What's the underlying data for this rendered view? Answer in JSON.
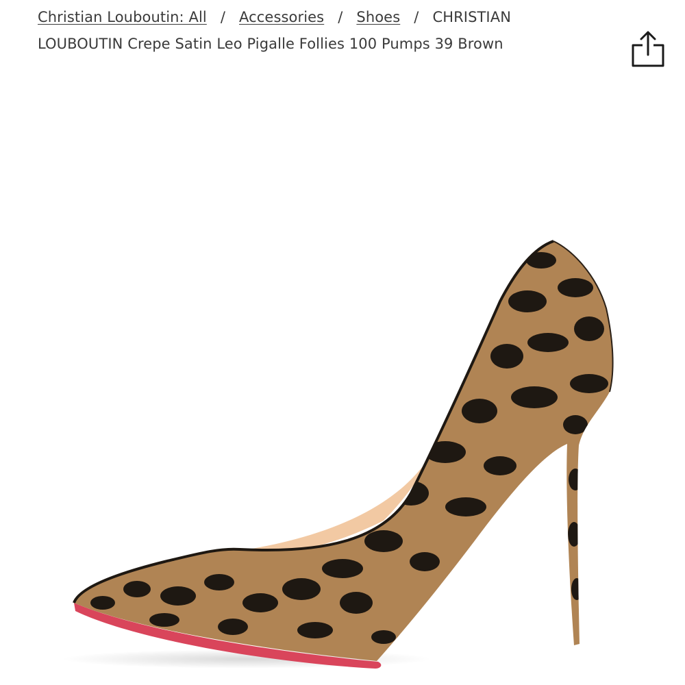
{
  "breadcrumb": {
    "items": [
      {
        "label": "Christian Louboutin: All"
      },
      {
        "label": "Accessories"
      },
      {
        "label": "Shoes"
      }
    ],
    "separator": "/",
    "current": "CHRISTIAN LOUBOUTIN Crepe Satin Leo Pigalle Follies 100 Pumps 39 Brown"
  },
  "toolbar": {
    "share_icon": "share-icon"
  },
  "product": {
    "image_subject": "leopard print pointed-toe stiletto pump with red sole",
    "colors": {
      "leopard_base": "#b08454",
      "leopard_spots": "#1e1812",
      "lining": "#f2c9a3",
      "sole": "#d9455b"
    }
  }
}
